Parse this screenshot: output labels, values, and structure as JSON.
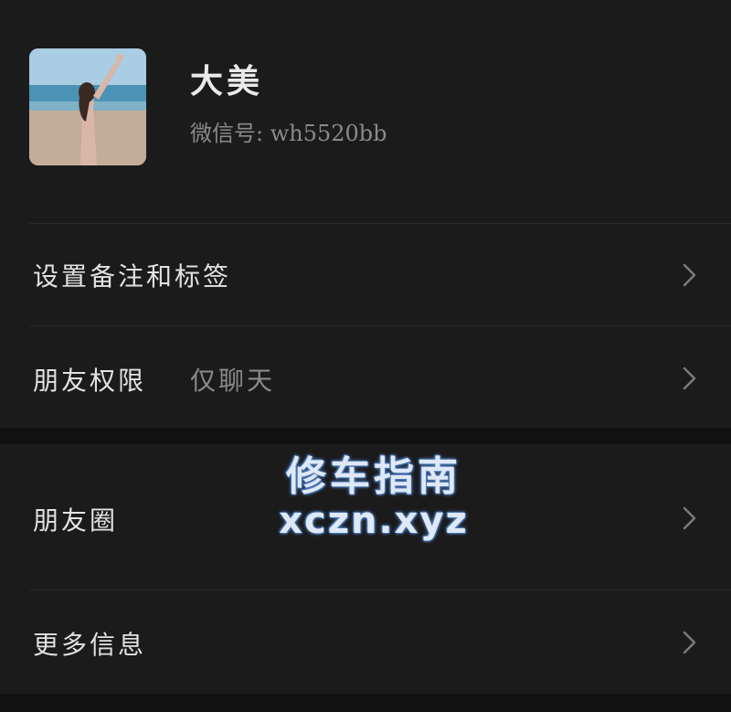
{
  "profile": {
    "name": "大美",
    "wechat_id_label": "微信号: wh5520bb"
  },
  "rows": [
    {
      "label": "设置备注和标签",
      "value": ""
    },
    {
      "label": "朋友权限",
      "value": "仅聊天"
    },
    {
      "label": "朋友圈",
      "value": ""
    },
    {
      "label": "更多信息",
      "value": ""
    }
  ],
  "watermark": {
    "line1": "修车指南",
    "line2": "xczn.xyz"
  },
  "icons": {
    "chevron": "chevron-right-icon"
  },
  "colors": {
    "background": "#1b1b1b",
    "section_gap": "#111111",
    "primary_text": "#e2e2e2",
    "secondary_text": "#8a8a8a"
  }
}
